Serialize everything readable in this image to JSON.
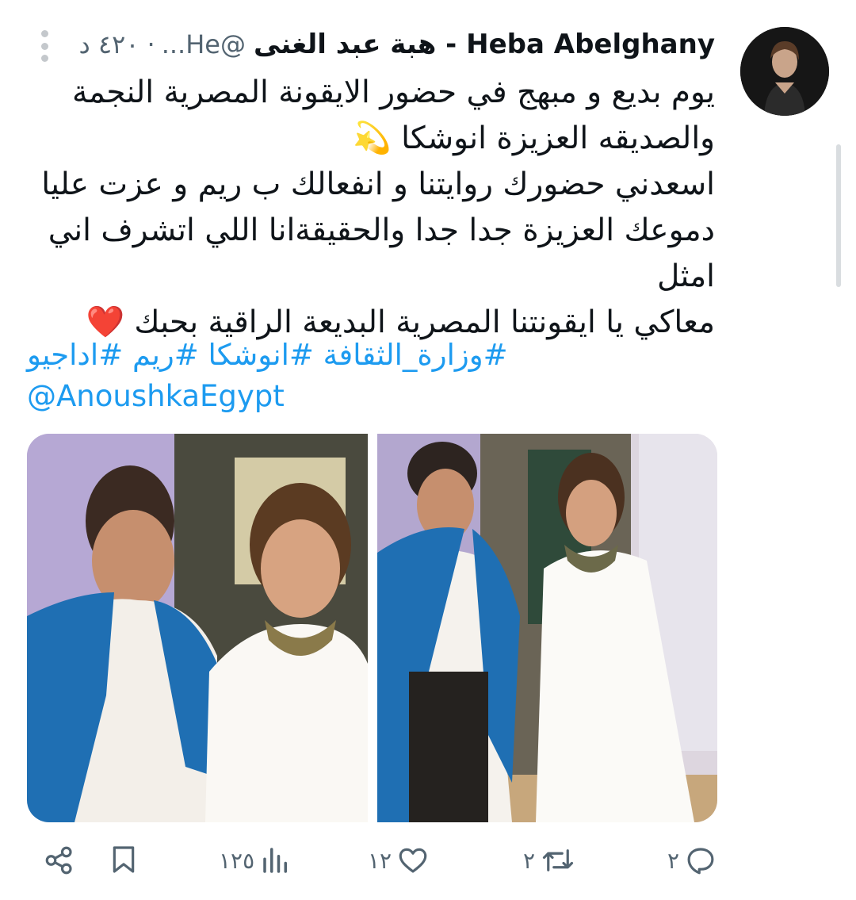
{
  "tweet": {
    "display_name": "Heba Abelghany - هبة عبد الغنى",
    "handle": "@He...",
    "dot": "·",
    "time": "٤٢٠ د",
    "text_lines": [
      "يوم بديع و مبهج في حضور الايقونة المصرية النجمة",
      "والصديقه العزيزة انوشكا 💫",
      "اسعدني حضورك روايتنا و انفعالك ب ريم و عزت عليا",
      "دموعك العزيزة جدا جدا والحقيقةانا اللي اتشرف اني امثل",
      "معاكي يا ايقونتنا المصرية البديعة الراقية بحبك ❤️"
    ],
    "hashtags": "#وزارة_الثقافة #انوشكا #ريم #اداجيو",
    "mention": "@AnoushkaEgypt"
  },
  "icons": {
    "more": "more-vertical-icon",
    "share": "share-icon",
    "bookmark": "bookmark-icon",
    "views": "views-icon",
    "like": "heart-icon",
    "retweet": "retweet-icon",
    "reply": "reply-icon"
  },
  "actions": {
    "views_count": "١٢٥",
    "likes_count": "١٢",
    "retweets_count": "٢",
    "replies_count": "٢"
  },
  "colors": {
    "link": "#1d9bf0",
    "secondary_text": "#536471",
    "scarf": "#1f6fb3"
  }
}
